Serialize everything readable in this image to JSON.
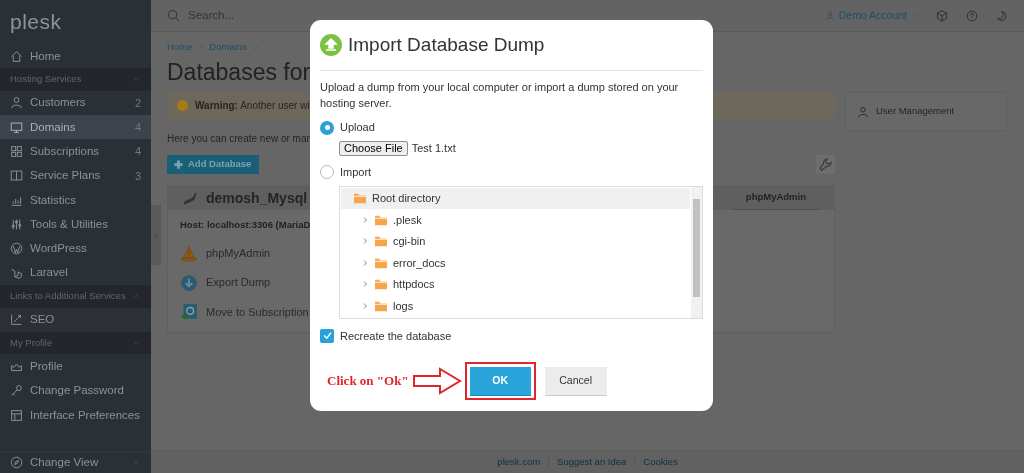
{
  "sidebar": {
    "logo": "plesk",
    "items": [
      {
        "kind": "item",
        "label": "Home",
        "selected": false
      },
      {
        "kind": "section",
        "label": "Hosting Services",
        "expanded": true
      },
      {
        "kind": "item",
        "label": "Customers",
        "count": "2",
        "selected": false
      },
      {
        "kind": "item",
        "label": "Domains",
        "count": "4",
        "selected": true
      },
      {
        "kind": "item",
        "label": "Subscriptions",
        "count": "4",
        "selected": false
      },
      {
        "kind": "item",
        "label": "Service Plans",
        "count": "3",
        "selected": false
      },
      {
        "kind": "item",
        "label": "Statistics",
        "selected": false
      },
      {
        "kind": "item",
        "label": "Tools & Utilities",
        "selected": false
      },
      {
        "kind": "item",
        "label": "WordPress",
        "selected": false
      },
      {
        "kind": "item",
        "label": "Laravel",
        "selected": false
      },
      {
        "kind": "section",
        "label": "Links to Additional Services",
        "expanded": true
      },
      {
        "kind": "item",
        "label": "SEO",
        "selected": false
      },
      {
        "kind": "section",
        "label": "My Profile",
        "expanded": true
      },
      {
        "kind": "item",
        "label": "Profile",
        "selected": false
      },
      {
        "kind": "item",
        "label": "Change Password",
        "selected": false
      },
      {
        "kind": "item",
        "label": "Interface Preferences",
        "selected": false
      }
    ],
    "footer_item": {
      "label": "Change View"
    }
  },
  "topbar": {
    "search": {
      "placeholder": "Search..."
    },
    "account": "Demo Account"
  },
  "breadcrumb": [
    "Home",
    "Domains"
  ],
  "page_title": "Databases for",
  "warning": "**Warning:** Another user wi",
  "description": "Here you can create new or man",
  "toolbar": {
    "add_button": "Add Database"
  },
  "database": {
    "name": "demosh_Mysql",
    "tab": "phpMyAdmin",
    "host": "Host: localhost:3306 (MariaD",
    "actions": [
      "phpMyAdmin",
      "Export Dump",
      "Move to Subscription"
    ]
  },
  "side_panel": {
    "items": [
      "User Management"
    ]
  },
  "footer_links": [
    "plesk.com",
    "Suggest an Idea",
    "Cookies"
  ],
  "dialog": {
    "title": "Import Database Dump",
    "description": "Upload a dump from your local computer or import a dump stored on your hosting server.",
    "options": [
      {
        "label": "Upload",
        "selected": true
      },
      {
        "label": "Import",
        "selected": false
      }
    ],
    "file": {
      "button": "Choose File",
      "filename": "Test 1.txt"
    },
    "tree": {
      "label": "Root directory",
      "selected": true,
      "expanded": true,
      "children": [
        {
          "label": ".plesk",
          "expanded": false
        },
        {
          "label": "cgi-bin",
          "expanded": false
        },
        {
          "label": "error_docs",
          "expanded": false
        },
        {
          "label": "httpdocs",
          "expanded": false
        },
        {
          "label": "logs",
          "expanded": false
        }
      ]
    },
    "recreate": {
      "label": "Recreate the database",
      "checked": true
    },
    "buttons": [
      {
        "label": "OK",
        "kind": "primary",
        "highlighted": true
      },
      {
        "label": "Cancel",
        "kind": "secondary",
        "highlighted": false
      }
    ],
    "annotation": {
      "text": "Click on \"Ok\""
    }
  }
}
